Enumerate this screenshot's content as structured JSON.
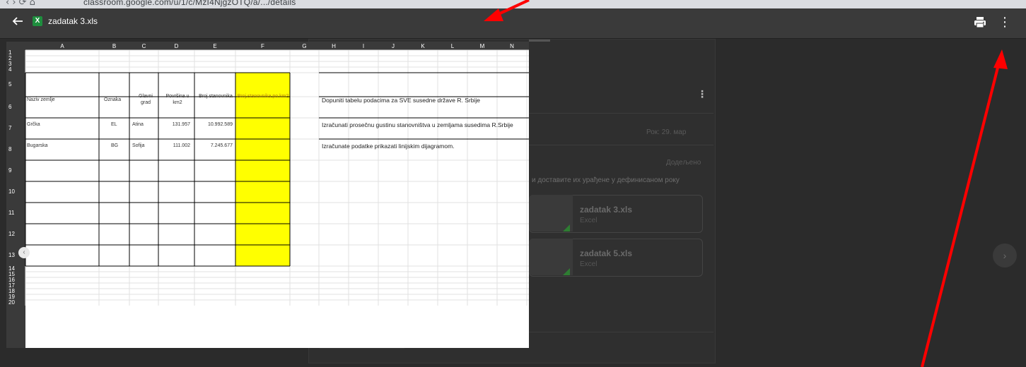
{
  "browser": {
    "nav_glyphs": "‹  ›  ⟳  ⌂",
    "url": "classroom.google.com/u/1/c/MzI4NjgzOTQ/a/.../details"
  },
  "viewer": {
    "back_icon": "arrow-left-icon",
    "file_icon_letter": "X",
    "file_name": "zadatak 3.xls",
    "print_icon": "printer-icon",
    "more_icon": "⋮",
    "next_glyph": "›",
    "prev_glyph": "‹"
  },
  "background_page": {
    "kebab": "⋮",
    "due_date": "Рок: 29. мар",
    "status": "Додељено",
    "instructions": "и доставите их урађене у дефинисаном року",
    "attachments": [
      {
        "title": "zadatak 3.xls",
        "type": "Excel"
      },
      {
        "title": "zadatak 5.xls",
        "type": "Excel"
      }
    ]
  },
  "sheet": {
    "columns": [
      "A",
      "B",
      "C",
      "D",
      "E",
      "F",
      "G",
      "H",
      "I",
      "J",
      "K",
      "L",
      "M",
      "N"
    ],
    "row_numbers": [
      "1",
      "2",
      "3",
      "4",
      "5",
      "6",
      "7",
      "8",
      "9",
      "10",
      "11",
      "12",
      "13",
      "14",
      "15",
      "16",
      "17",
      "18",
      "19",
      "20"
    ],
    "table": {
      "headers": [
        "Naziv zemlje",
        "Oznaka",
        "Glavni grad",
        "Površina u km2",
        "Broj stanovnika",
        "Broj stanovnika po km2"
      ],
      "rows": [
        [
          "Grčka",
          "EL",
          "Atina",
          "131.957",
          "10.992.589",
          ""
        ],
        [
          "Bugarska",
          "BG",
          "Sofija",
          "111.002",
          "7.245.677",
          ""
        ]
      ]
    },
    "notes": [
      "Dopuniti tabelu podacima za SVE susedne države R. Srbije",
      "Izračunati prosečnu gustinu stanovništva u zemljama susedima R.Srbije",
      "Izračunate podatke prikazati linijskim dijagramom."
    ],
    "highlight_color": "#ffff00"
  },
  "annotation": {
    "arrow_color": "#ff0000"
  }
}
